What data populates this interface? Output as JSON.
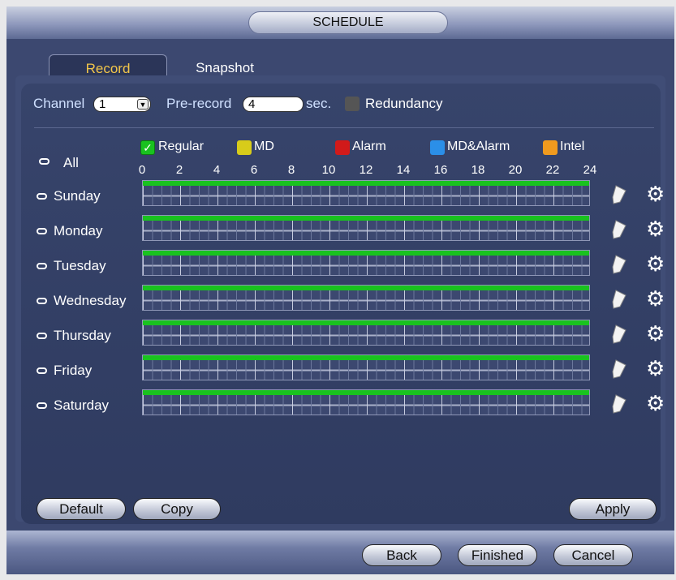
{
  "window": {
    "title": "SCHEDULE"
  },
  "tabs": [
    {
      "label": "Record",
      "active": true
    },
    {
      "label": "Snapshot",
      "active": false
    }
  ],
  "settings": {
    "channel_label": "Channel",
    "channel_value": "1",
    "prerecord_label": "Pre-record",
    "prerecord_value": "4",
    "prerecord_unit": "sec.",
    "redundancy_label": "Redundancy"
  },
  "legend": [
    {
      "label": "Regular",
      "color": "#19c21f",
      "checked": true
    },
    {
      "label": "MD",
      "color": "#d8cc1a"
    },
    {
      "label": "Alarm",
      "color": "#d11a1a"
    },
    {
      "label": "MD&Alarm",
      "color": "#2b8fe8"
    },
    {
      "label": "Intel",
      "color": "#f09a1e"
    }
  ],
  "all_label": "All",
  "hours": [
    "0",
    "2",
    "4",
    "6",
    "8",
    "10",
    "12",
    "14",
    "16",
    "18",
    "20",
    "22",
    "24"
  ],
  "days": [
    {
      "label": "Sunday"
    },
    {
      "label": "Monday"
    },
    {
      "label": "Tuesday"
    },
    {
      "label": "Wednesday"
    },
    {
      "label": "Thursday"
    },
    {
      "label": "Friday"
    },
    {
      "label": "Saturday"
    }
  ],
  "row_icons": {
    "edit": "pencil-icon",
    "settings": "gear-icon"
  },
  "buttons": {
    "default": "Default",
    "copy": "Copy",
    "apply": "Apply",
    "back": "Back",
    "finished": "Finished",
    "cancel": "Cancel"
  }
}
